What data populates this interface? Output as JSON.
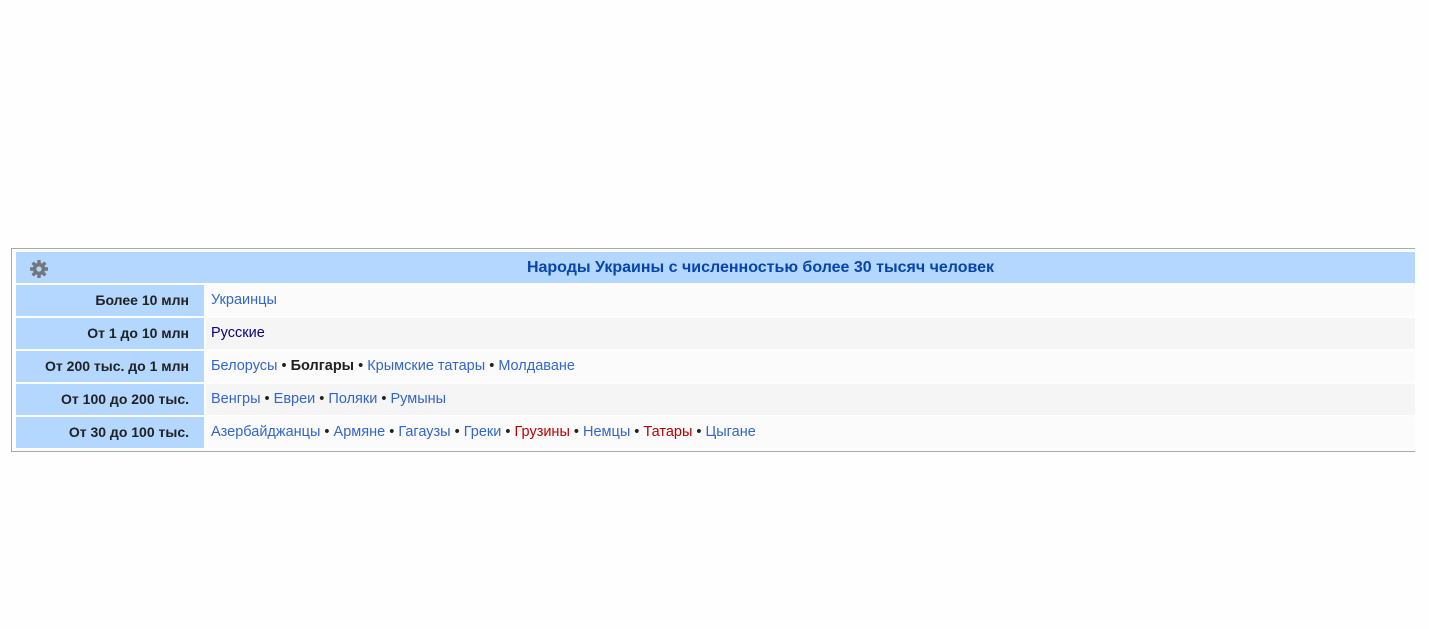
{
  "navbox": {
    "title": "Народы Украины с численностью более 30 тысяч человек",
    "gear_icon": "gear-icon",
    "accent_color": "#b3d7ff",
    "separator": " • ",
    "groups": [
      {
        "label": "Более 10 млн",
        "items": [
          {
            "text": "Украинцы",
            "kind": "link"
          }
        ]
      },
      {
        "label": "От 1 до 10 млн",
        "items": [
          {
            "text": "Русские",
            "kind": "visited"
          }
        ]
      },
      {
        "label": "От 200 тыс. до 1 млн",
        "items": [
          {
            "text": "Белорусы",
            "kind": "link"
          },
          {
            "text": "Болгары",
            "kind": "self"
          },
          {
            "text": "Крымские татары",
            "kind": "link"
          },
          {
            "text": "Молдаване",
            "kind": "link"
          }
        ]
      },
      {
        "label": "От 100 до 200 тыс.",
        "items": [
          {
            "text": "Венгры",
            "kind": "link"
          },
          {
            "text": "Евреи",
            "kind": "link"
          },
          {
            "text": "Поляки",
            "kind": "link"
          },
          {
            "text": "Румыны",
            "kind": "link"
          }
        ]
      },
      {
        "label": "От 30 до 100 тыс.",
        "items": [
          {
            "text": "Азербайджанцы",
            "kind": "link"
          },
          {
            "text": "Армяне",
            "kind": "link"
          },
          {
            "text": "Гагаузы",
            "kind": "link"
          },
          {
            "text": "Греки",
            "kind": "link"
          },
          {
            "text": "Грузины",
            "kind": "new"
          },
          {
            "text": "Немцы",
            "kind": "link"
          },
          {
            "text": "Татары",
            "kind": "new"
          },
          {
            "text": "Цыгане",
            "kind": "link"
          }
        ]
      }
    ]
  }
}
